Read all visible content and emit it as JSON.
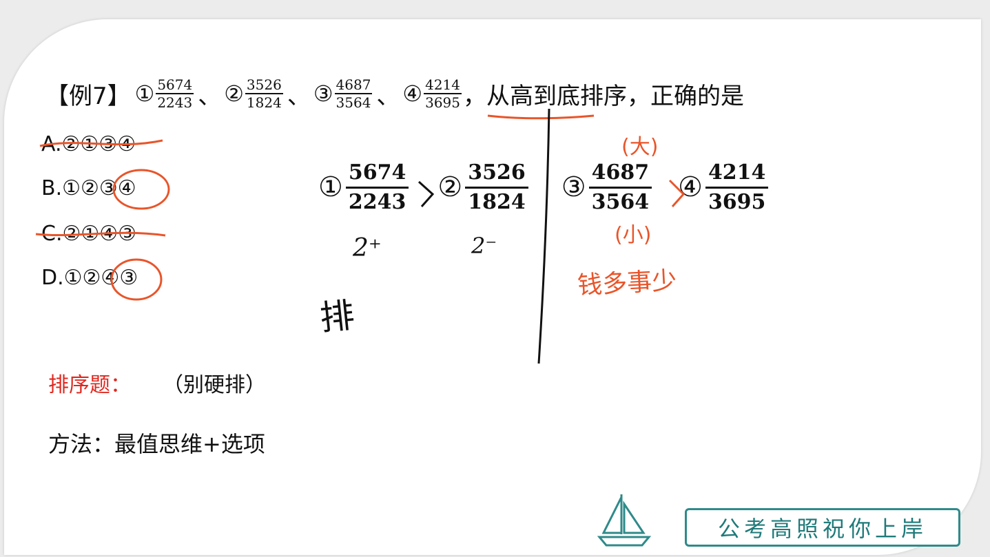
{
  "question": {
    "prefix": "【例7】",
    "items": [
      {
        "mark": "①",
        "num": "5674",
        "den": "2243"
      },
      {
        "mark": "②",
        "num": "3526",
        "den": "1824"
      },
      {
        "mark": "③",
        "num": "4687",
        "den": "3564"
      },
      {
        "mark": "④",
        "num": "4214",
        "den": "3695"
      }
    ],
    "separator": "、",
    "tail": "，从高到底排序，正确的是"
  },
  "options": [
    {
      "label": "A.②①③④",
      "struck": true
    },
    {
      "label": "B.①②③④",
      "struck": false
    },
    {
      "label": "C.②①④③",
      "struck": true
    },
    {
      "label": "D.①②④③",
      "struck": false
    }
  ],
  "worked": {
    "items": [
      {
        "mark": "①",
        "num": "5674",
        "den": "2243"
      },
      {
        "mark": "②",
        "num": "3526",
        "den": "1824"
      },
      {
        "mark": "③",
        "num": "4687",
        "den": "3564"
      },
      {
        "mark": "④",
        "num": "4214",
        "den": "3695"
      }
    ]
  },
  "handwriting": {
    "two_plus": "2⁺",
    "two_minus": "2⁻",
    "pai": "排",
    "big": "(大)",
    "small": "(小)",
    "qian_duo": "钱多事少"
  },
  "notes": {
    "sort_label": "排序题：",
    "sort_note": "（别硬排）",
    "method": "方法：最值思维+选项"
  },
  "logo": {
    "text": "公考高照祝你上岸",
    "icon": "sailboat-icon"
  },
  "colors": {
    "accent_red": "#e0281f",
    "ink_orange": "#e8552a",
    "logo_teal": "#2f8a8a"
  }
}
